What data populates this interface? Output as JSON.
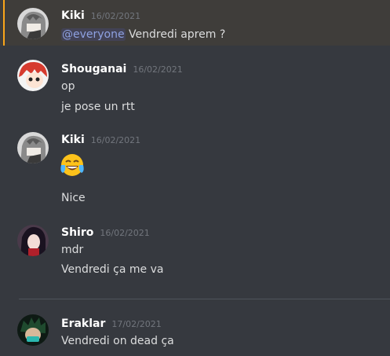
{
  "messages": [
    {
      "author": "Kiki",
      "timestamp": "16/02/2021",
      "mention": "@everyone",
      "text": " Vendredi aprem ?"
    },
    {
      "author": "Shouganai",
      "timestamp": "16/02/2021",
      "lines": [
        "op",
        "je pose un rtt"
      ]
    },
    {
      "author": "Kiki",
      "timestamp": "16/02/2021",
      "emoji": "face-with-tears-of-joy",
      "lines": [
        "Nice"
      ]
    },
    {
      "author": "Shiro",
      "timestamp": "16/02/2021",
      "lines": [
        "mdr",
        "Vendredi ça me va"
      ]
    },
    {
      "author": "Eraklar",
      "timestamp": "17/02/2021",
      "lines": [
        "Vendredi on dead ça"
      ]
    }
  ],
  "colors": {
    "background": "#36393f",
    "highlight": "#faa61a",
    "mention": "#8ea1e1",
    "username": "#ffffff",
    "timestamp": "#72767d"
  }
}
